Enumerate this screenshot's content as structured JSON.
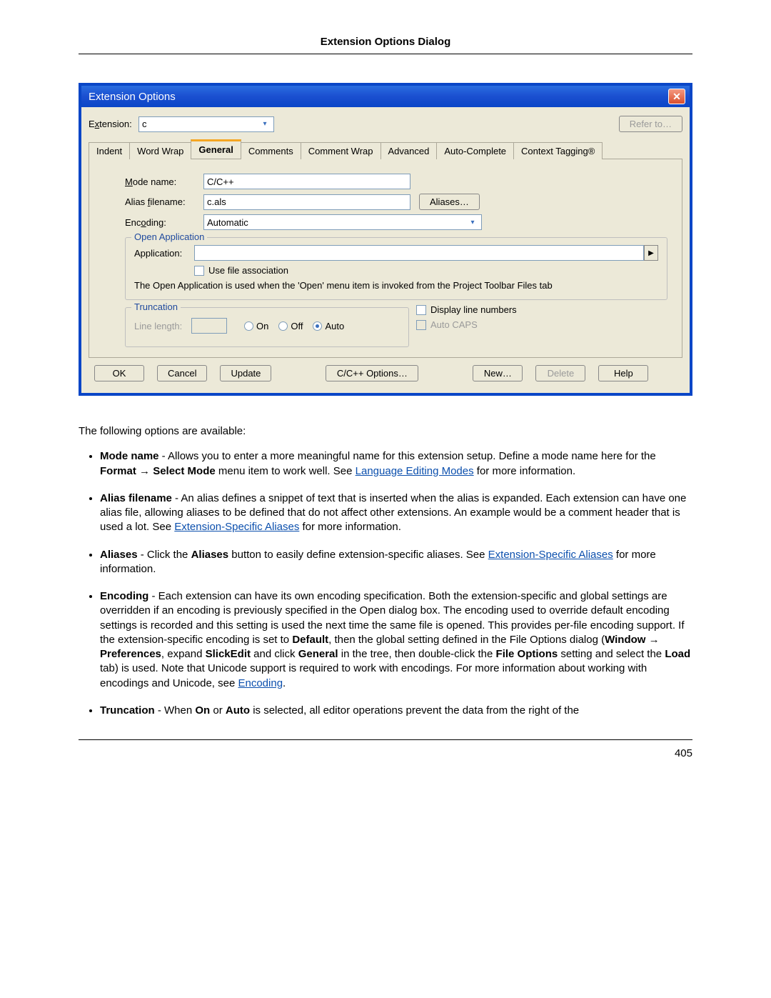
{
  "doc": {
    "title": "Extension Options Dialog",
    "intro": "The following options are available:",
    "pageNumber": "405",
    "bullets": {
      "b1": {
        "name": "Mode name",
        "t1": " - Allows you to enter a more meaningful name for this extension setup. Define a mode name here for the ",
        "bold1": "Format",
        "arrow": " → ",
        "bold2": "Select Mode",
        "t2": " menu item to work well. See ",
        "link": "Language Editing Modes",
        "t3": " for more information."
      },
      "b2": {
        "name": "Alias filename",
        "t1": " - An alias defines a snippet of text that is inserted when the alias is expanded. Each extension can have one alias file, allowing aliases to be defined that do not affect other extensions. An example would be a comment header that is used a lot. See ",
        "link": "Extension-Specific Aliases",
        "t2": " for more information."
      },
      "b3": {
        "name": "Aliases",
        "t1": " - Click the ",
        "bold1": "Aliases",
        "t2": " button to easily define extension-specific aliases. See ",
        "link": "Extension-Specific Aliases",
        "t3": " for more information."
      },
      "b4": {
        "name": "Encoding",
        "t1": " - Each extension can have its own encoding specification. Both the extension-specific and global settings are overridden if an encoding is previously specified in the Open dialog box. The encoding used to override default encoding settings is recorded and this setting is used the next time the same file is opened. This provides per-file encoding support. If the extension-specific encoding is set to ",
        "bold1": "Default",
        "t2": ", then the global setting defined in the File Options dialog (",
        "bold2": "Window",
        "arrow": " → ",
        "bold3": "Preferences",
        "t3": ", expand ",
        "bold4": "SlickEdit",
        "t4": " and click ",
        "bold5": "General",
        "t5": " in the tree, then double-click the ",
        "bold6": "File Options",
        "t6": " setting and select the ",
        "bold7": "Load",
        "t7": " tab) is used. Note that Unicode support is required to work with encodings. For more information about working with encodings and Unicode, see ",
        "link": "Encoding",
        "t8": "."
      },
      "b5": {
        "name": "Truncation",
        "t1": " - When ",
        "bold1": "On",
        "t2": " or ",
        "bold2": "Auto",
        "t3": " is selected, all editor operations prevent the data from the right of the"
      }
    }
  },
  "dialog": {
    "title": "Extension Options",
    "ext_label": "Extension:",
    "ext_value": "c",
    "refer_btn": "Refer to…",
    "tabs": {
      "indent": "Indent",
      "wordwrap": "Word Wrap",
      "general": "General",
      "comments": "Comments",
      "commentwrap": "Comment Wrap",
      "advanced": "Advanced",
      "autocomplete": "Auto-Complete",
      "context": "Context Tagging®"
    },
    "general": {
      "mode_label": "Mode name:",
      "mode_value": "C/C++",
      "alias_label": "Alias filename:",
      "alias_value": "c.als",
      "aliases_btn": "Aliases…",
      "encoding_label": "Encoding:",
      "encoding_value": "Automatic",
      "openapp_legend": "Open Application",
      "app_label": "Application:",
      "usefile_label": "Use file association",
      "openapp_help": "The Open Application is used when the 'Open' menu item is invoked from the Project Toolbar Files tab",
      "trunc_legend": "Truncation",
      "linelen_label": "Line length:",
      "r_on": "On",
      "r_off": "Off",
      "r_auto": "Auto",
      "disp_line": "Display line numbers",
      "autocaps": "Auto CAPS"
    },
    "buttons": {
      "ok": "OK",
      "cancel": "Cancel",
      "update": "Update",
      "lang": "C/C++ Options…",
      "new": "New…",
      "delete": "Delete",
      "help": "Help"
    }
  }
}
